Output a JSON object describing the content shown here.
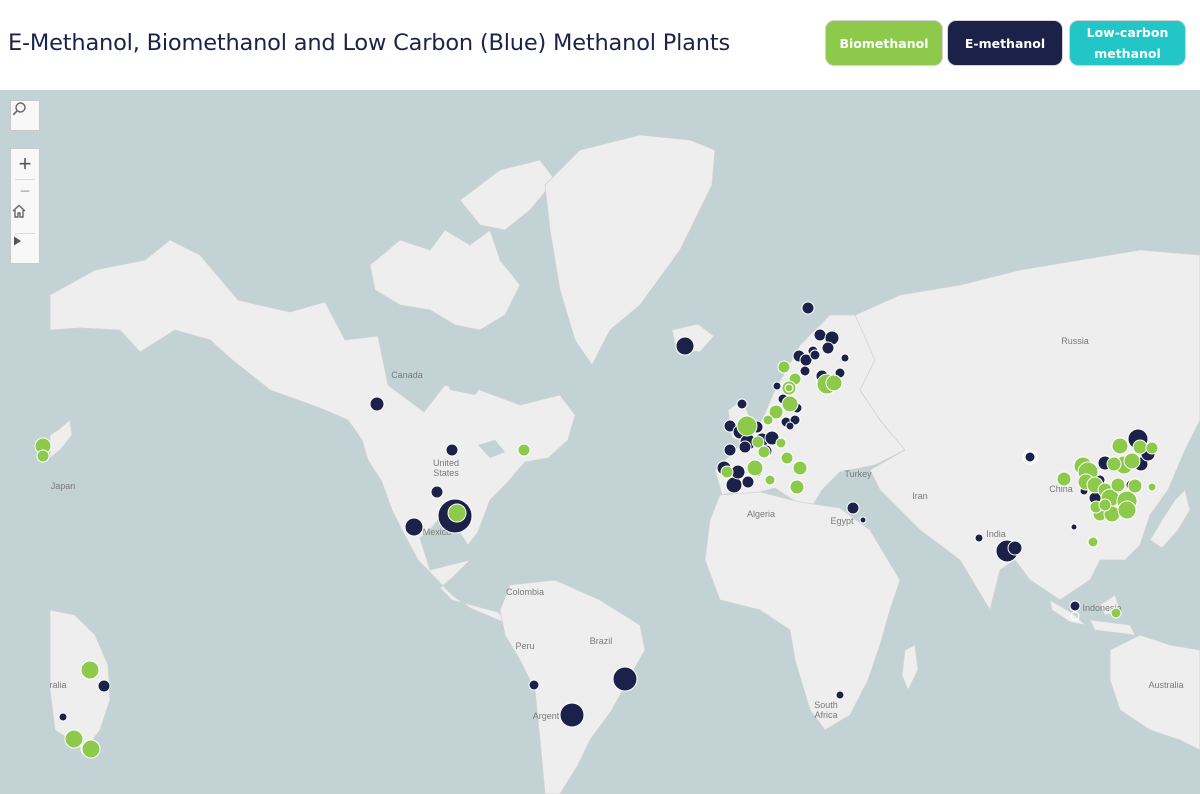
{
  "title": "E-Methanol, Biomethanol and Low Carbon (Blue) Methanol Plants",
  "legend": {
    "biomethanol": {
      "label": "Biomethanol",
      "color": "#8dc94b"
    },
    "emethanol": {
      "label": "E-methanol",
      "color": "#1b2148"
    },
    "lowcarbon": {
      "label": "Low-carbon methanol",
      "color": "#22c6c6"
    }
  },
  "map_controls": {
    "search": {
      "icon": "search-icon"
    },
    "zoom_in": {
      "glyph": "+"
    },
    "zoom_out": {
      "glyph": "−"
    },
    "home": {
      "icon": "home-icon"
    },
    "play": {
      "icon": "play-icon"
    }
  },
  "map": {
    "land_color": "#eeeeee",
    "water_color": "#c3d2d4",
    "border_color": "#d2d2d2",
    "labels": {
      "canada": "Canada",
      "united_states": "United States",
      "mexico": "Mexico",
      "colombia": "Colombia",
      "peru": "Peru",
      "brazil": "Brazil",
      "argentina": "Argent",
      "russia": "Russia",
      "china": "China",
      "india": "India",
      "iran": "Iran",
      "turkey": "Turkey",
      "egypt": "Egypt",
      "algeria": "Algeria",
      "south_africa": "South Africa",
      "indonesia": "Indonesia",
      "australia": "Australia",
      "australia_west": "ralia",
      "japan": "Japan"
    }
  }
}
